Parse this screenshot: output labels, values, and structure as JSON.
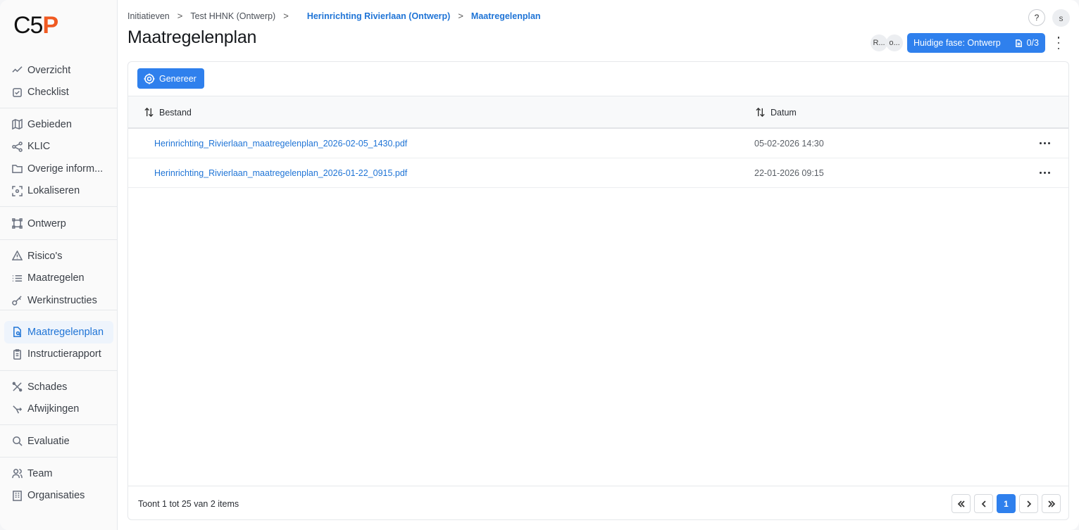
{
  "app": {
    "logo_prefix": "C5",
    "logo_accent": "P",
    "accent_color": "#2f80ed",
    "brand_color": "#f05a22"
  },
  "sidebar": {
    "groups": [
      [
        {
          "label": "Overzicht",
          "icon": "trend-icon"
        },
        {
          "label": "Checklist",
          "icon": "checkbox-icon"
        }
      ],
      [
        {
          "label": "Gebieden",
          "icon": "map-icon"
        },
        {
          "label": "KLIC",
          "icon": "share-icon"
        },
        {
          "label": "Overige inform...",
          "icon": "folder-icon"
        },
        {
          "label": "Lokaliseren",
          "icon": "locate-icon"
        }
      ],
      [
        {
          "label": "Ontwerp",
          "icon": "frame-icon"
        }
      ],
      [
        {
          "label": "Risico's",
          "icon": "warning-icon"
        },
        {
          "label": "Maatregelen",
          "icon": "list-icon"
        },
        {
          "label": "Werkinstructies",
          "icon": "key-icon"
        }
      ],
      [
        {
          "label": "Maatregelenplan",
          "icon": "file-search-icon",
          "active": true
        },
        {
          "label": "Instructierapport",
          "icon": "clipboard-icon"
        }
      ],
      [
        {
          "label": "Schades",
          "icon": "tools-icon"
        },
        {
          "label": "Afwijkingen",
          "icon": "deviation-icon"
        }
      ],
      [
        {
          "label": "Evaluatie",
          "icon": "search-icon"
        }
      ],
      [
        {
          "label": "Team",
          "icon": "users-icon"
        },
        {
          "label": "Organisaties",
          "icon": "building-icon"
        }
      ]
    ]
  },
  "breadcrumb": {
    "items": [
      "Initiatieven",
      "Test HHNK (Ontwerp)",
      "Herinrichting Rivierlaan (Ontwerp)",
      "Maatregelenplan"
    ],
    "separator": ">"
  },
  "header": {
    "title": "Maatregelenplan",
    "help": "?",
    "user_initial": "s",
    "avatars": [
      "R...",
      "o..."
    ],
    "phase_label": "Huidige fase: Ontwerp",
    "phase_count": "0/3"
  },
  "toolbar": {
    "generate_label": "Genereer"
  },
  "table": {
    "columns": [
      "Bestand",
      "Datum"
    ],
    "rows": [
      {
        "file": "Herinrichting_Rivierlaan_maatregelenplan_2026-02-05_1430.pdf",
        "date": "05-02-2026 14:30"
      },
      {
        "file": "Herinrichting_Rivierlaan_maatregelenplan_2026-01-22_0915.pdf",
        "date": "22-01-2026 09:15"
      }
    ],
    "summary": "Toont 1 tot 25 van 2 items"
  },
  "pagination": {
    "current": "1"
  }
}
